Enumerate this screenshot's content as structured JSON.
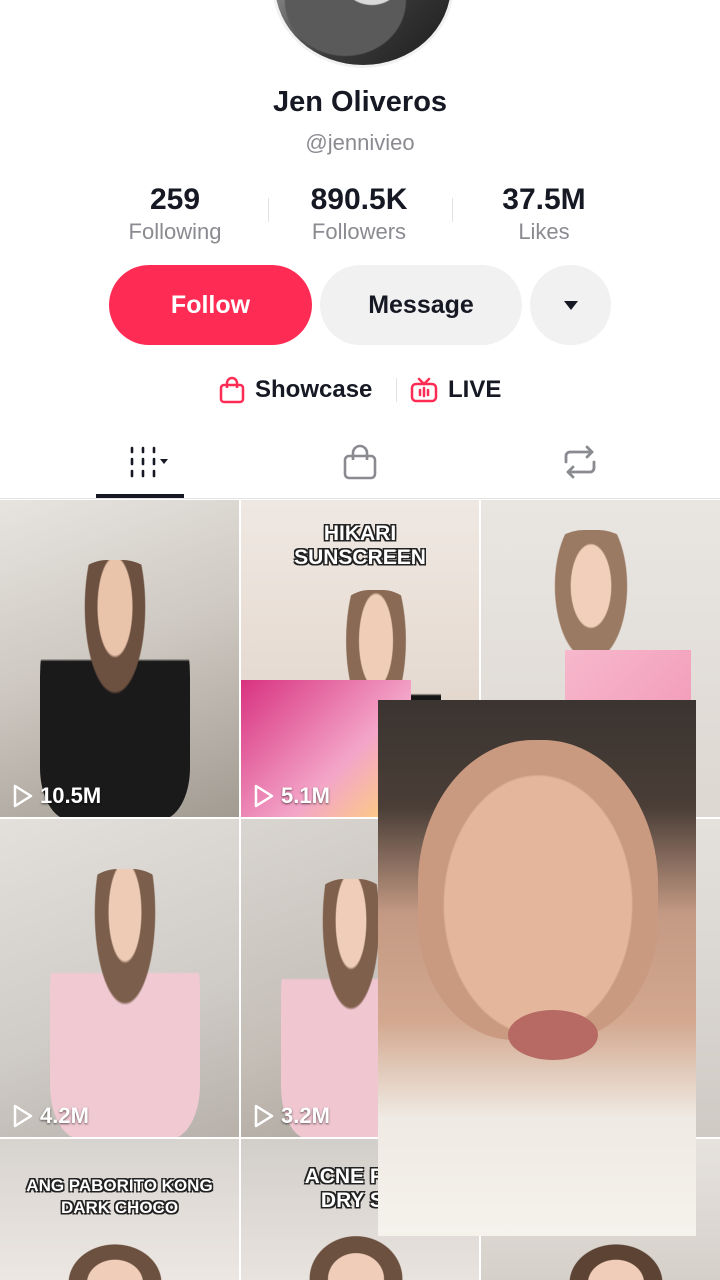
{
  "profile": {
    "name": "Jen Oliveros",
    "handle": "@jennivieo"
  },
  "stats": [
    {
      "value": "259",
      "label": "Following"
    },
    {
      "value": "890.5K",
      "label": "Followers"
    },
    {
      "value": "37.5M",
      "label": "Likes"
    }
  ],
  "actions": {
    "follow": "Follow",
    "message": "Message"
  },
  "links": {
    "showcase": "Showcase",
    "live": "LIVE"
  },
  "colors": {
    "brand": "#fe2c55",
    "secondary_button": "#f1f1f2",
    "muted_text": "#8a8b91"
  },
  "icons": {
    "more": "caret-down-icon",
    "showcase": "shopping-bag-icon",
    "live": "live-tv-icon",
    "tab_videos": "grid-icon",
    "tab_shop": "shopping-bag-icon",
    "tab_reposts": "repost-icon",
    "play": "play-icon"
  },
  "videos": [
    {
      "views": "10.5M",
      "caption": ""
    },
    {
      "views": "5.1M",
      "caption": "HIKARI SUNSCREEN"
    },
    {
      "views": "",
      "caption": ""
    },
    {
      "views": "4.2M",
      "caption": ""
    },
    {
      "views": "3.2M",
      "caption": ""
    },
    {
      "views": "",
      "caption": ""
    },
    {
      "views": "",
      "caption": "ANG PABORITO KONG DARK CHOCO"
    },
    {
      "views": "",
      "caption": "ACNE PRO DRY SK"
    },
    {
      "views": "",
      "caption": ""
    }
  ]
}
